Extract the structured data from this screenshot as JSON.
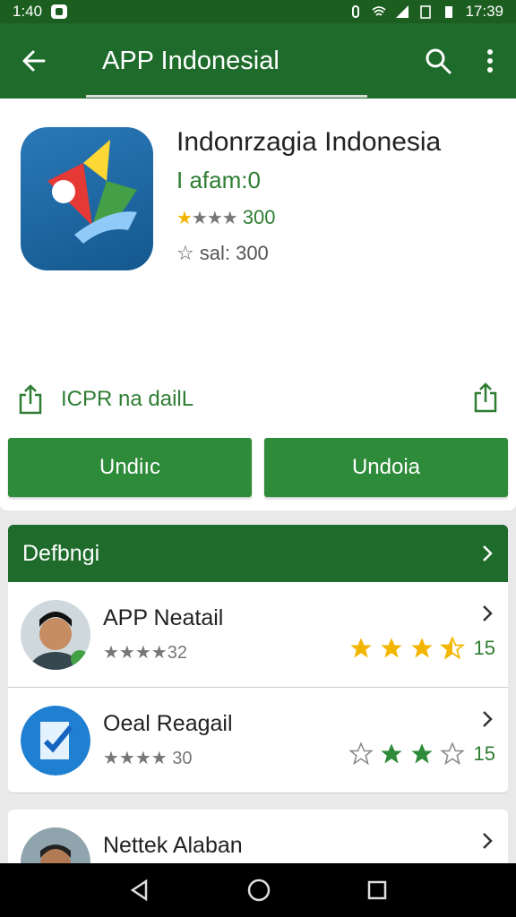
{
  "status": {
    "time_left": "1:40",
    "time_right": "17:39"
  },
  "appbar": {
    "title": "APP Indonesial",
    "back_icon": "arrow-left-icon",
    "search_icon": "search-icon",
    "more_icon": "more-vert-icon"
  },
  "app": {
    "name": "Indonrzagia Indonesia",
    "subtitle": "I afam:0",
    "rating_label": "300",
    "rating_stars": 1,
    "size_label": "sal: 300",
    "share_label": "ICPR na dailL",
    "button_left": "Undiıc",
    "button_right": "Undoia"
  },
  "section": {
    "title": "Defbngi"
  },
  "rows": [
    {
      "name": "APP Neatail",
      "sub": "32",
      "stars_filled": 3.5,
      "rating": "15",
      "avatar": "person-avatar"
    },
    {
      "name": "Oeal Reagail",
      "sub": "30",
      "stars_filled": 2,
      "rating": "15",
      "avatar": "document-check-icon"
    },
    {
      "name": "Nettek Alaban",
      "sub": "",
      "stars_filled": 0,
      "rating": "",
      "avatar": "person-avatar"
    }
  ],
  "colors": {
    "primary": "#1e6b2b",
    "accent": "#2e8b3a",
    "star": "#f2b600"
  }
}
